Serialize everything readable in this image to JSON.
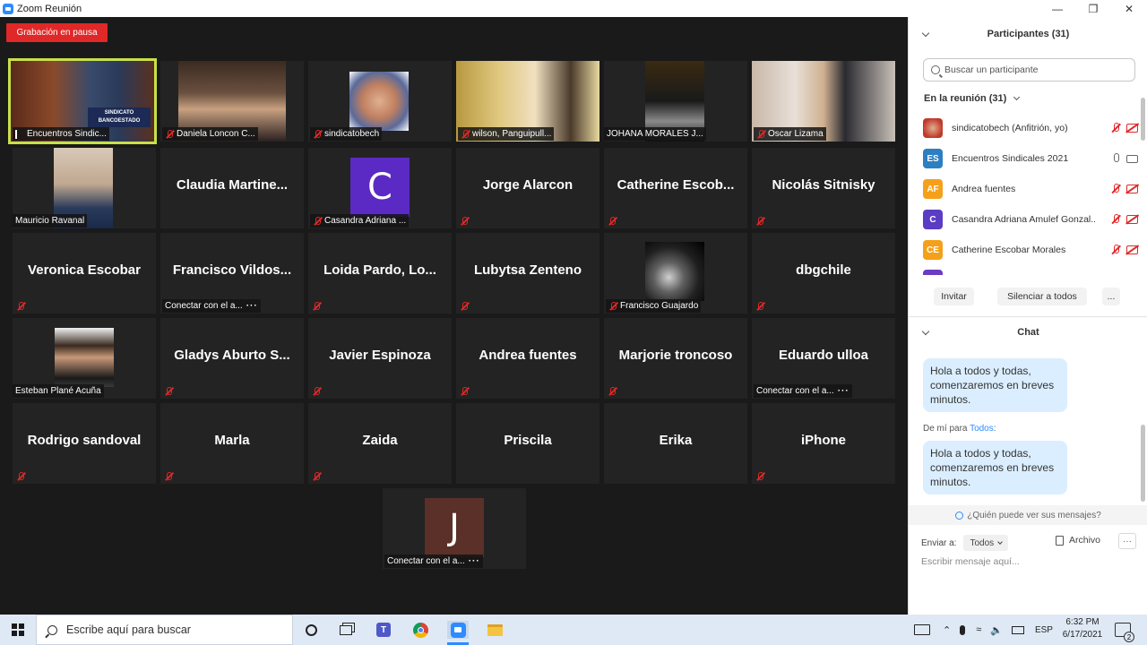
{
  "window": {
    "title": "Zoom Reunión"
  },
  "recording": {
    "label": "Grabación en pausa"
  },
  "tiles": [
    {
      "id": "t1",
      "label": "Encuentros Sindic...",
      "sign": "SINDICATO BANCOESTADO"
    },
    {
      "id": "t2",
      "label": "Daniela Loncon C..."
    },
    {
      "id": "t3",
      "label": "sindicatobech"
    },
    {
      "id": "t4",
      "label": "wilson, Panguipull..."
    },
    {
      "id": "t5",
      "label": "JOHANA MORALES J..."
    },
    {
      "id": "t6",
      "label": "Oscar Lizama"
    },
    {
      "id": "t7",
      "label": "Mauricio Ravanal"
    },
    {
      "id": "t8",
      "big": "Claudia  Martine..."
    },
    {
      "id": "t9",
      "label": "Casandra Adriana ...",
      "avatar": "C"
    },
    {
      "id": "t10",
      "big": "Jorge Alarcon"
    },
    {
      "id": "t11",
      "big": "Catherine  Escob..."
    },
    {
      "id": "t12",
      "big": "Nicolás Sitnisky"
    },
    {
      "id": "t13",
      "big": "Veronica Escobar"
    },
    {
      "id": "t14",
      "big": "Francisco  Vildos...",
      "label": "Conectar con el a..."
    },
    {
      "id": "t15",
      "big": "Loida Pardo, Lo..."
    },
    {
      "id": "t16",
      "big": "Lubytsa Zenteno"
    },
    {
      "id": "t17",
      "label": "Francisco Guajardo"
    },
    {
      "id": "t18",
      "big": "dbgchile"
    },
    {
      "id": "t19",
      "label": "Esteban Plané Acuña"
    },
    {
      "id": "t20",
      "big": "Gladys Aburto S..."
    },
    {
      "id": "t21",
      "big": "Javier Espinoza"
    },
    {
      "id": "t22",
      "big": "Andrea fuentes"
    },
    {
      "id": "t23",
      "big": "Marjorie troncoso"
    },
    {
      "id": "t24",
      "big": "Eduardo ulloa",
      "label": "Conectar con el a..."
    },
    {
      "id": "t25",
      "big": "Rodrigo sandoval"
    },
    {
      "id": "t26",
      "big": "Marla"
    },
    {
      "id": "t27",
      "big": "Zaida"
    },
    {
      "id": "t28",
      "big": "Priscila"
    },
    {
      "id": "t29",
      "big": "Erika"
    },
    {
      "id": "t30",
      "big": "iPhone"
    },
    {
      "id": "t31",
      "label": "Conectar con el a...",
      "avatar": "J"
    }
  ],
  "participants": {
    "header": "Participantes (31)",
    "search_placeholder": "Buscar un participante",
    "in_meeting": "En la reunión (31)",
    "list": [
      {
        "initials": "",
        "name": "sindicatobech (Anfitrión, yo)",
        "color": "#c0392b"
      },
      {
        "initials": "ES",
        "name": "Encuentros Sindicales 2021",
        "color": "#2d7fc1"
      },
      {
        "initials": "AF",
        "name": "Andrea fuentes",
        "color": "#f5a01a"
      },
      {
        "initials": "C",
        "name": "Casandra Adriana Amulef Gonzal...",
        "color": "#5b3cc4"
      },
      {
        "initials": "CE",
        "name": "Catherine Escobar Morales",
        "color": "#f5a01a"
      }
    ],
    "invite": "Invitar",
    "mute_all": "Silenciar a todos",
    "more": "..."
  },
  "chat": {
    "header": "Chat",
    "message1": "Hola a todos y todas, comenzaremos en breves minutos.",
    "from_prefix": "De mí para ",
    "from_to": "Todos",
    "from_suffix": ":",
    "message2": "Hola a todos y todas, comenzaremos en breves minutos.",
    "who_sees": "¿Quién puede ver sus mensajes?",
    "send_to": "Enviar a:",
    "send_to_value": "Todos",
    "file": "Archivo",
    "more": "···",
    "input_placeholder": "Escribir mensaje aquí..."
  },
  "taskbar": {
    "search_placeholder": "Escribe aquí para buscar",
    "lang": "ESP",
    "time": "6:32 PM",
    "date": "6/17/2021",
    "notif_count": "2"
  }
}
